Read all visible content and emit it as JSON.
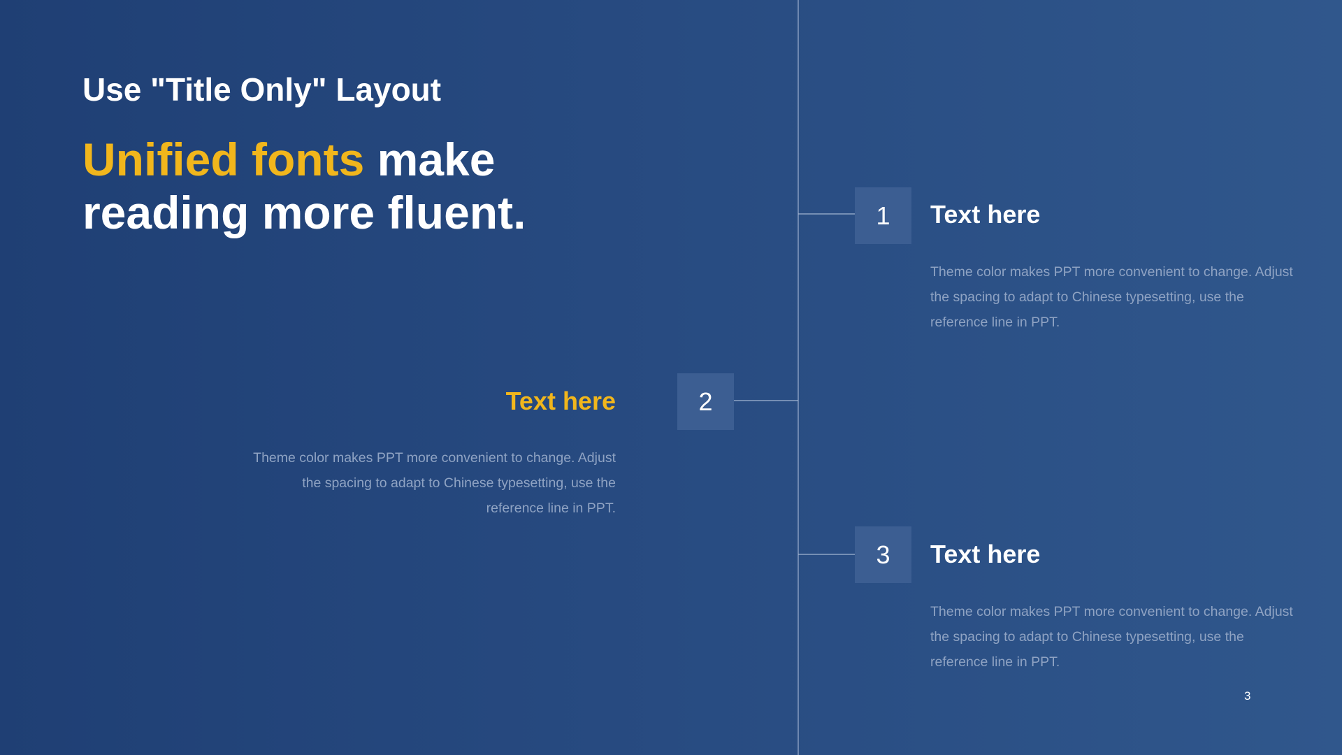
{
  "slide": {
    "title": "Use \"Title Only\" Layout",
    "headline": {
      "accent": "Unified fonts",
      "rest_line1": " make",
      "line2": "reading more fluent."
    },
    "items": [
      {
        "number": "1",
        "title": "Text here",
        "body": "Theme color makes PPT more convenient to change. Adjust the spacing to adapt to Chinese typesetting, use the reference line in PPT."
      },
      {
        "number": "2",
        "title": "Text here",
        "body": "Theme color makes PPT more convenient to change. Adjust the spacing to adapt to Chinese typesetting, use the reference line in PPT."
      },
      {
        "number": "3",
        "title": "Text here",
        "body": "Theme color makes PPT more convenient to change. Adjust the spacing to adapt to Chinese typesetting, use the reference line in PPT."
      }
    ],
    "page_number": "3"
  },
  "colors": {
    "background_left": "#1f3f74",
    "background_right": "#30578c",
    "accent": "#f1b61c",
    "number_box": "#3c5e92",
    "body_text": "#8fa3c3"
  }
}
